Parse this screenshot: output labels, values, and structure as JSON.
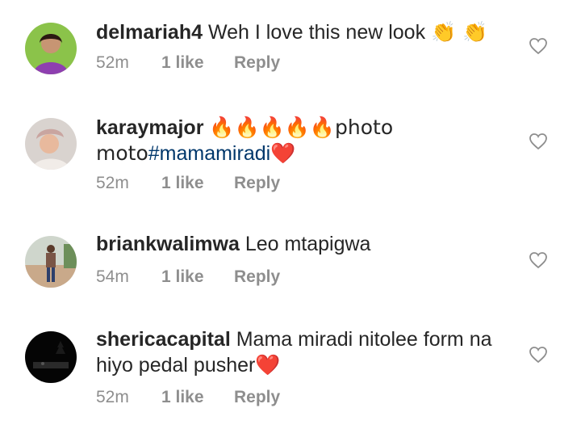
{
  "comments": [
    {
      "username": "delmariah4",
      "text": "Weh I love this new look",
      "emoji_after": "👏 👏",
      "hashtag": "",
      "text_after_hashtag": "",
      "time": "52m",
      "likes": "1 like",
      "reply": "Reply",
      "avatar_icon": "avatar-woman-purple-icon"
    },
    {
      "username": "karaymajor",
      "text": "🔥🔥🔥🔥🔥photo moto",
      "emoji_after": "",
      "hashtag": "#mamamiradi",
      "text_after_hashtag": "❤️",
      "time": "52m",
      "likes": "1 like",
      "reply": "Reply",
      "avatar_icon": "avatar-woman-headwrap-icon"
    },
    {
      "username": "briankwalimwa",
      "text": "Leo mtapigwa",
      "emoji_after": "",
      "hashtag": "",
      "text_after_hashtag": "",
      "time": "54m",
      "likes": "1 like",
      "reply": "Reply",
      "avatar_icon": "avatar-man-road-icon"
    },
    {
      "username": "sherica​capital",
      "text": "Mama miradi nitolee form na hiyo pedal pusher",
      "emoji_after": "",
      "hashtag": "",
      "text_after_hashtag": "❤️",
      "time": "52m",
      "likes": "1 like",
      "reply": "Reply",
      "avatar_icon": "avatar-night-scene-icon"
    }
  ],
  "colors": {
    "text": "#262626",
    "meta": "#8e8e8e",
    "hashtag": "#00376b",
    "heart_emoji": "#e0245e"
  }
}
